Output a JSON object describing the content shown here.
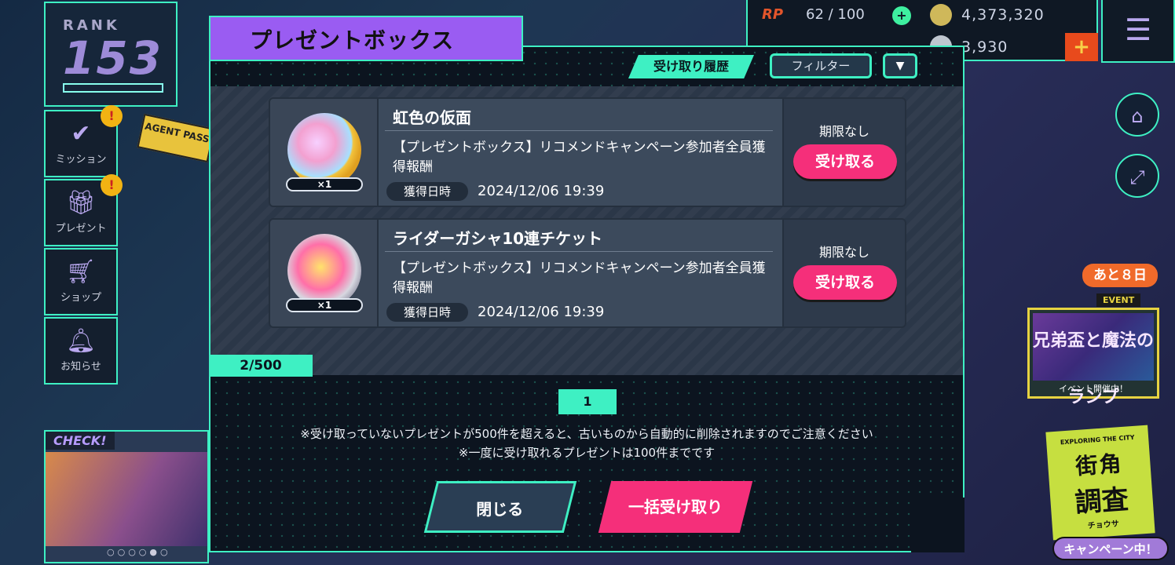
{
  "hud": {
    "rank_label": "RANK",
    "rank_value": "153",
    "rp_label": "RP",
    "rp_value": "62 / 100",
    "coins": "4,373,320",
    "gems": "3,930"
  },
  "sidebar": {
    "items": [
      {
        "label": "ミッション",
        "icon": "check-icon",
        "alert": "!"
      },
      {
        "label": "プレゼント",
        "icon": "gift-icon",
        "alert": "!"
      },
      {
        "label": "ショップ",
        "icon": "cart-icon"
      },
      {
        "label": "お知らせ",
        "icon": "bell-icon"
      }
    ]
  },
  "agent_pass": "AGENT PASS",
  "check_banner": {
    "label": "CHECK!"
  },
  "event": {
    "countdown": "あと８日",
    "label": "EVENT",
    "status": "イベント開催中！",
    "title": "兄弟盃と魔法のランプ"
  },
  "city_campaign": {
    "tagline": "EXPLORING THE CITY",
    "title_top": "街角",
    "title_main": "調査",
    "kana": "チョウサ",
    "badge": "キャンペーン中！"
  },
  "modal": {
    "title": "プレゼントボックス",
    "history_button": "受け取り履歴",
    "filter_button": "フィルター",
    "sort_glyph": "▼",
    "items": [
      {
        "name": "虹色の仮面",
        "quantity": "×1",
        "description": "【プレゼントボックス】リコメンドキャンペーン参加者全員獲得報酬",
        "date_label": "獲得日時",
        "date": "2024/12/06 19:39",
        "limit": "期限なし",
        "receive_label": "受け取る"
      },
      {
        "name": "ライダーガシャ10連チケット",
        "quantity": "×1",
        "description": "【プレゼントボックス】リコメンドキャンペーン参加者全員獲得報酬",
        "date_label": "獲得日時",
        "date": "2024/12/06 19:39",
        "limit": "期限なし",
        "receive_label": "受け取る"
      }
    ],
    "count": "2/500",
    "page": "1",
    "note1": "※受け取っていないプレゼントが500件を超えると、古いものから自動的に削除されますのでご注意ください",
    "note2": "※一度に受け取れるプレゼントは100件までです",
    "close_label": "閉じる",
    "bulk_label": "一括受け取り"
  }
}
